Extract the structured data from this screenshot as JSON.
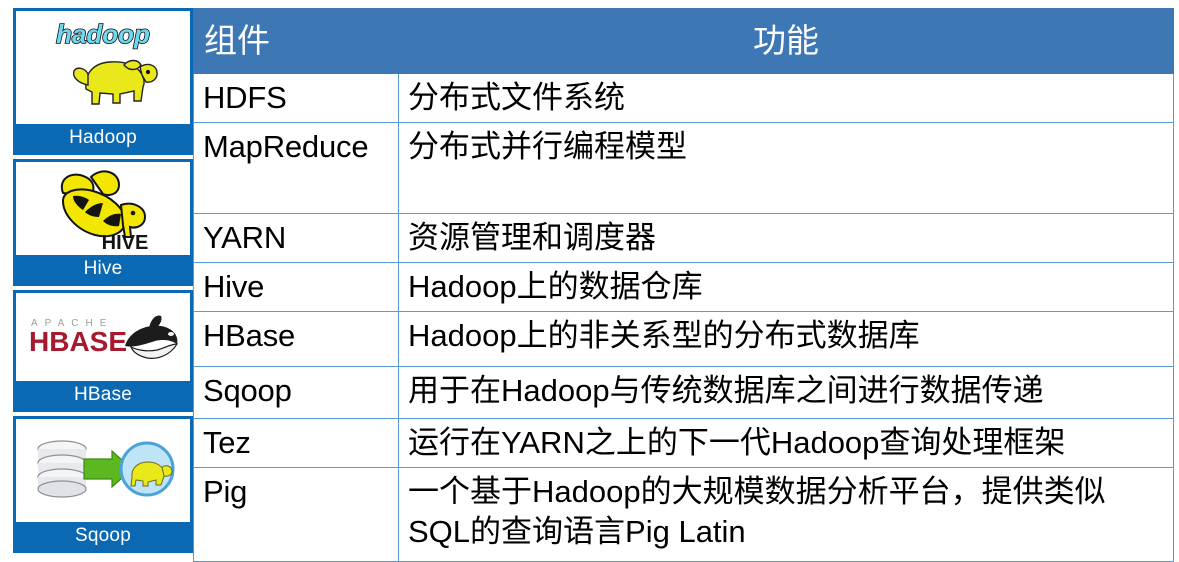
{
  "sidebar": {
    "tiles": [
      {
        "id": "hadoop",
        "label": "Hadoop",
        "logo": "hadoop-elephant-logo",
        "logo_alt": "hadoop"
      },
      {
        "id": "hive",
        "label": "Hive",
        "logo": "hive-bee-elephant-logo",
        "logo_alt": "HIVE"
      },
      {
        "id": "hbase",
        "label": "HBase",
        "logo": "hbase-orca-logo",
        "logo_alt": "APACHE HBASE"
      },
      {
        "id": "sqoop",
        "label": "Sqoop",
        "logo": "sqoop-database-arrow-elephant-logo",
        "logo_alt": "Sqoop"
      }
    ]
  },
  "table": {
    "headers": {
      "component": "组件",
      "function": "功能"
    },
    "rows": [
      {
        "component": "HDFS",
        "function": "分布式文件系统"
      },
      {
        "component": "MapReduce",
        "function": "分布式并行编程模型"
      },
      {
        "component": "YARN",
        "function": "资源管理和调度器"
      },
      {
        "component": "Hive",
        "function": "Hadoop上的数据仓库"
      },
      {
        "component": "HBase",
        "function": "Hadoop上的非关系型的分布式数据库"
      },
      {
        "component": "Sqoop",
        "function": "用于在Hadoop与传统数据库之间进行数据传递"
      },
      {
        "component": "Tez",
        "function": "运行在YARN之上的下一代Hadoop查询处理框架"
      },
      {
        "component": "Pig",
        "function": "一个基于Hadoop的大规模数据分析平台，提供类似\nSQL的查询语言Pig Latin"
      }
    ]
  },
  "colors": {
    "tile_blue": "#0b69b4",
    "header_blue": "#3d78b5",
    "table_border": "#5b9bd5",
    "hadoop_yellow": "#e8e81a",
    "hbase_red": "#a6192e"
  }
}
